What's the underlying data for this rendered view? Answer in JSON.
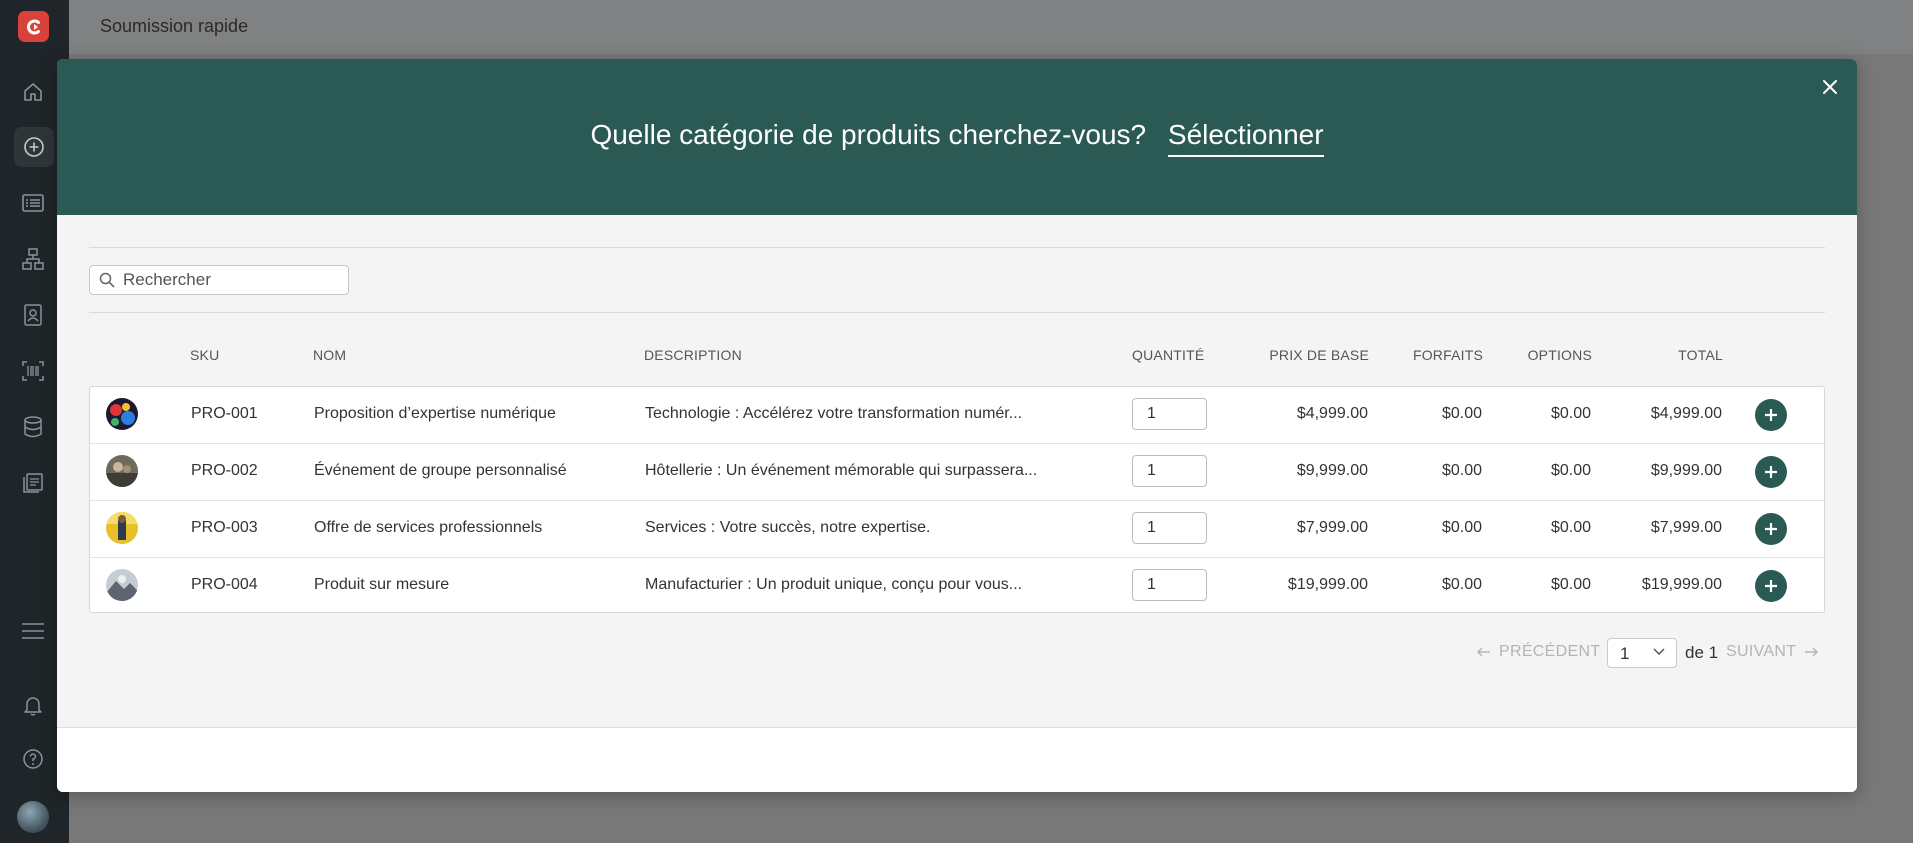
{
  "app": {
    "page_title": "Soumission rapide"
  },
  "sidebar": {
    "items": [
      {
        "icon": "home-icon"
      },
      {
        "icon": "plus-circle-icon",
        "active": true
      },
      {
        "icon": "list-icon"
      },
      {
        "icon": "hierarchy-icon"
      },
      {
        "icon": "contacts-icon"
      },
      {
        "icon": "barcode-icon"
      },
      {
        "icon": "database-icon"
      },
      {
        "icon": "catalog-icon"
      }
    ],
    "bottom": [
      {
        "icon": "menu-icon"
      },
      {
        "icon": "bell-icon"
      },
      {
        "icon": "help-icon"
      }
    ]
  },
  "modal": {
    "question": "Quelle catégorie de produits cherchez-vous?",
    "select_label": "Sélectionner",
    "search": {
      "placeholder": "Rechercher",
      "value": ""
    },
    "columns": {
      "sku": "SKU",
      "name": "NOM",
      "description": "DESCRIPTION",
      "quantity": "QUANTITÉ",
      "base_price": "PRIX DE BASE",
      "packages": "FORFAITS",
      "options": "OPTIONS",
      "total": "TOTAL"
    },
    "rows": [
      {
        "sku": "PRO-001",
        "name": "Proposition d’expertise numérique",
        "description": "Technologie : Accélérez votre transformation numér...",
        "quantity": "1",
        "base_price": "$4,999.00",
        "packages": "$0.00",
        "options": "$0.00",
        "total": "$4,999.00"
      },
      {
        "sku": "PRO-002",
        "name": "Événement de groupe personnalisé",
        "description": "Hôtellerie : Un événement mémorable qui surpassera...",
        "quantity": "1",
        "base_price": "$9,999.00",
        "packages": "$0.00",
        "options": "$0.00",
        "total": "$9,999.00"
      },
      {
        "sku": "PRO-003",
        "name": "Offre de services professionnels",
        "description": "Services : Votre succès, notre expertise.",
        "quantity": "1",
        "base_price": "$7,999.00",
        "packages": "$0.00",
        "options": "$0.00",
        "total": "$7,999.00"
      },
      {
        "sku": "PRO-004",
        "name": "Produit sur mesure",
        "description": "Manufacturier : Un produit unique, conçu pour vous...",
        "quantity": "1",
        "base_price": "$19,999.00",
        "packages": "$0.00",
        "options": "$0.00",
        "total": "$19,999.00"
      }
    ],
    "pagination": {
      "prev_label": "PRÉCÉDENT",
      "next_label": "SUIVANT",
      "current_page": "1",
      "of_label": "de 1"
    }
  },
  "colors": {
    "brand_green": "#2a5a53",
    "logo_red": "#d9423a",
    "rail": "#1f2528"
  }
}
